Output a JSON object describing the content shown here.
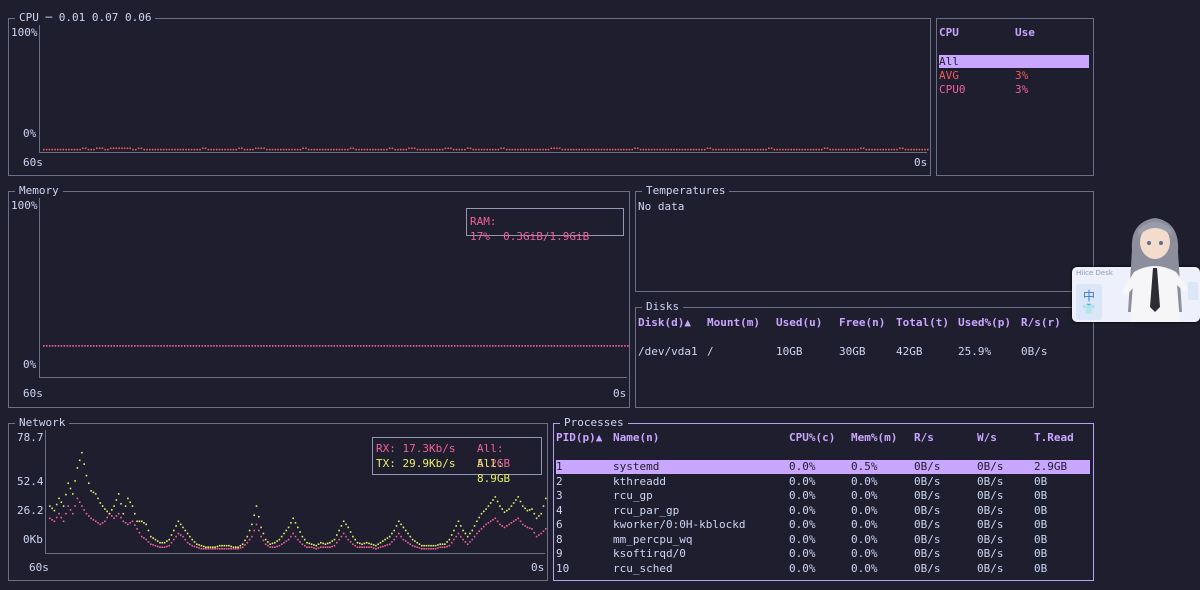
{
  "cpu": {
    "title": "CPU",
    "load_avg": "0.01 0.07 0.06",
    "y_top": "100%",
    "y_bottom": "0%",
    "x_left": "60s",
    "x_right": "0s",
    "line_color": "#f05a5a",
    "series_percent": [
      1,
      1,
      1,
      1,
      1,
      1,
      1,
      1,
      1,
      1,
      1,
      1,
      1,
      1,
      2,
      2,
      1,
      1,
      1,
      2,
      2,
      2,
      1,
      1,
      2,
      2,
      2,
      2,
      2,
      2,
      2,
      2,
      1,
      1,
      2,
      2,
      1,
      1,
      1,
      1,
      1,
      1,
      1,
      1,
      1,
      1,
      1,
      1,
      1,
      1,
      1,
      1,
      1,
      1,
      1,
      1,
      1,
      2,
      2,
      1,
      1,
      1,
      1,
      1,
      1,
      1,
      1,
      1,
      1,
      1,
      2,
      2,
      1,
      1,
      1,
      1,
      2,
      2,
      2,
      2,
      1,
      1,
      1,
      1,
      1,
      1,
      1,
      1,
      1,
      1,
      1,
      1,
      1,
      2,
      2,
      1,
      1,
      1,
      1,
      1,
      1,
      1,
      1,
      1,
      1,
      1,
      1,
      1,
      1,
      1,
      2,
      2,
      1,
      1,
      1,
      1,
      1,
      1,
      1,
      1,
      1,
      1,
      1,
      1,
      2,
      2,
      1,
      1,
      1,
      1,
      1,
      2,
      2,
      2,
      1,
      1,
      1,
      1,
      1,
      1,
      1,
      1,
      1,
      1,
      2,
      2,
      2,
      1,
      1,
      1,
      1,
      1,
      2,
      2,
      1,
      1,
      1,
      1,
      1,
      1,
      1,
      1,
      1,
      1,
      2,
      2,
      1,
      1,
      1,
      1,
      1,
      1,
      1,
      1,
      1,
      1,
      1,
      1,
      1,
      1,
      1,
      1,
      2,
      2,
      2,
      2,
      1,
      1,
      1,
      1,
      1,
      1,
      1,
      1,
      1,
      1,
      1,
      1,
      1,
      1,
      1,
      1,
      1,
      1,
      1,
      1,
      1,
      1,
      1,
      1,
      1,
      1,
      2,
      2,
      1,
      1,
      1,
      1,
      1,
      1,
      1,
      1,
      1,
      1,
      1,
      1,
      1,
      1,
      1,
      1,
      1,
      1,
      1,
      1,
      1,
      1,
      1,
      1,
      2,
      2,
      1,
      1,
      1,
      1,
      1,
      1,
      1,
      1,
      1,
      1,
      1,
      1,
      1,
      1,
      1,
      1,
      1,
      1,
      1,
      1,
      2,
      2,
      1,
      1,
      1,
      1,
      1,
      1,
      1,
      1,
      1,
      1,
      1,
      1,
      1,
      1,
      1,
      1,
      1,
      1,
      2,
      2,
      1,
      1,
      1,
      1,
      1,
      1,
      1,
      1,
      1,
      1,
      1,
      2,
      2,
      1,
      1,
      1,
      1,
      1,
      1,
      1,
      1,
      1,
      1,
      1,
      1,
      2,
      2,
      1,
      1,
      1,
      1,
      1,
      1,
      1,
      1,
      1
    ]
  },
  "cpu_table": {
    "headers": [
      "CPU",
      "Use"
    ],
    "rows": [
      {
        "name": "All",
        "use": ""
      },
      {
        "name": "AVG",
        "use": "3%"
      },
      {
        "name": "CPU0",
        "use": "3%"
      }
    ]
  },
  "memory": {
    "title": "Memory",
    "y_top": "100%",
    "y_bottom": "0%",
    "x_left": "60s",
    "x_right": "0s",
    "ram_label": "RAM: 17%",
    "ram_value": "0.3GiB/1.9GiB",
    "ram_percent": 17,
    "line_color": "#f0629a"
  },
  "temperatures": {
    "title": "Temperatures",
    "text": "No data"
  },
  "disks": {
    "title": "Disks",
    "headers": [
      "Disk(d)▲",
      "Mount(m)",
      "Used(u)",
      "Free(n)",
      "Total(t)",
      "Used%(p)",
      "R/s(r)"
    ],
    "rows": [
      [
        "/dev/vda1",
        "/",
        "10GB",
        "30GB",
        "42GB",
        "25.9%",
        "0B/s"
      ]
    ]
  },
  "network": {
    "title": "Network",
    "y_ticks": [
      "78.7",
      "52.4",
      "26.2",
      "0Kb"
    ],
    "y_max": 78.7,
    "x_left": "60s",
    "x_right": "0s",
    "rx_label": "RX: 17.3Kb/s",
    "rx_all": "All: 5.2GB",
    "tx_label": "TX: 29.9Kb/s",
    "tx_all": "All: 8.9GB",
    "rx_color": "#f0629a",
    "tx_color": "#e6f06a",
    "tx_series": [
      30,
      27,
      35,
      30,
      45,
      38,
      55,
      65,
      50,
      40,
      38,
      32,
      28,
      25,
      30,
      38,
      25,
      35,
      30,
      20,
      20,
      18,
      10,
      8,
      6,
      6,
      8,
      14,
      20,
      16,
      12,
      8,
      5,
      4,
      3,
      3,
      3,
      4,
      4,
      4,
      3,
      3,
      5,
      10,
      18,
      30,
      16,
      8,
      5,
      6,
      8,
      12,
      16,
      22,
      16,
      10,
      6,
      5,
      4,
      6,
      5,
      6,
      8,
      14,
      20,
      16,
      10,
      6,
      5,
      6,
      5,
      4,
      6,
      8,
      10,
      14,
      20,
      16,
      12,
      8,
      6,
      4,
      4,
      4,
      4,
      5,
      5,
      8,
      14,
      20,
      14,
      10,
      14,
      20,
      25,
      28,
      32,
      36,
      30,
      26,
      28,
      32,
      36,
      30,
      27,
      28,
      22,
      25,
      35
    ],
    "rx_series": [
      22,
      20,
      25,
      20,
      30,
      25,
      35,
      30,
      25,
      22,
      20,
      18,
      20,
      25,
      22,
      25,
      20,
      18,
      20,
      15,
      10,
      8,
      5,
      4,
      3,
      3,
      4,
      8,
      12,
      10,
      6,
      4,
      3,
      2,
      2,
      2,
      2,
      2,
      2,
      2,
      2,
      2,
      3,
      6,
      10,
      18,
      10,
      5,
      3,
      3,
      4,
      6,
      8,
      12,
      8,
      5,
      3,
      3,
      2,
      3,
      3,
      3,
      4,
      8,
      12,
      8,
      5,
      3,
      3,
      3,
      3,
      2,
      3,
      4,
      5,
      8,
      12,
      8,
      6,
      4,
      3,
      2,
      2,
      2,
      2,
      3,
      3,
      4,
      8,
      12,
      8,
      5,
      8,
      12,
      15,
      18,
      20,
      22,
      18,
      16,
      18,
      20,
      22,
      18,
      16,
      15,
      10,
      12,
      15
    ]
  },
  "processes": {
    "title": "Processes",
    "headers": [
      "PID(p)▲",
      "Name(n)",
      "CPU%(c)",
      "Mem%(m)",
      "R/s",
      "W/s",
      "T.Read"
    ],
    "rows": [
      [
        "1",
        "systemd",
        "0.0%",
        "0.5%",
        "0B/s",
        "0B/s",
        "2.9GB"
      ],
      [
        "2",
        "kthreadd",
        "0.0%",
        "0.0%",
        "0B/s",
        "0B/s",
        "0B"
      ],
      [
        "3",
        "rcu_gp",
        "0.0%",
        "0.0%",
        "0B/s",
        "0B/s",
        "0B"
      ],
      [
        "4",
        "rcu_par_gp",
        "0.0%",
        "0.0%",
        "0B/s",
        "0B/s",
        "0B"
      ],
      [
        "6",
        "kworker/0:0H-kblockd",
        "0.0%",
        "0.0%",
        "0B/s",
        "0B/s",
        "0B"
      ],
      [
        "8",
        "mm_percpu_wq",
        "0.0%",
        "0.0%",
        "0B/s",
        "0B/s",
        "0B"
      ],
      [
        "9",
        "ksoftirqd/0",
        "0.0%",
        "0.0%",
        "0B/s",
        "0B/s",
        "0B"
      ],
      [
        "10",
        "rcu_sched",
        "0.0%",
        "0.0%",
        "0B/s",
        "0B/s",
        "0B"
      ]
    ]
  },
  "widget": {
    "label": "Hiice Desk",
    "ime_glyph": "中",
    "shirt_glyph": "👕"
  },
  "colors": {
    "background": "#1e1e2e",
    "border": "#6c7086",
    "accent": "#b4a3f0",
    "header": "#c9a6ff",
    "red": "#f05a5a",
    "pink": "#f0629a"
  }
}
